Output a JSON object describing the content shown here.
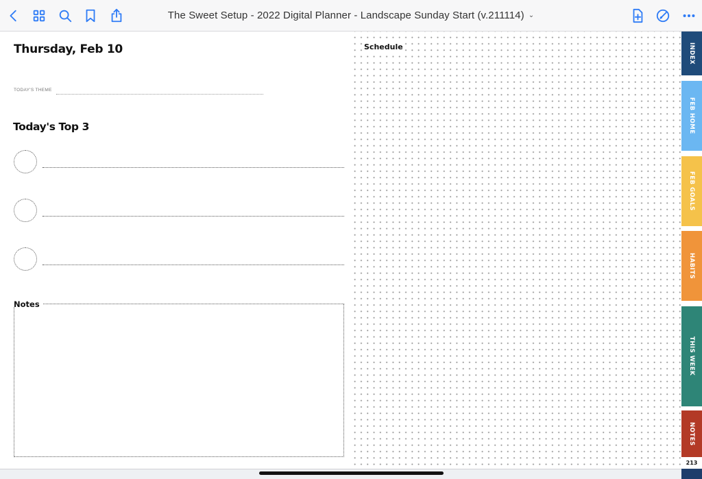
{
  "toolbar": {
    "title": "The Sweet Setup - 2022 Digital Planner - Landscape Sunday Start (v.211114)",
    "title_chevron": "⌄",
    "left_icons": [
      "back-icon",
      "grid-icon",
      "search-icon",
      "bookmark-icon",
      "share-icon"
    ],
    "right_icons": [
      "add-page-icon",
      "annotate-icon",
      "more-icon"
    ],
    "accent_color": "#2f7cf6"
  },
  "page": {
    "date": "Thursday, Feb 10",
    "theme_label": "TODAY'S THEME",
    "top3_heading": "Today's Top 3",
    "top3_count": 3,
    "notes_label": "Notes",
    "schedule_label": "Schedule",
    "page_number": "213"
  },
  "tabs": [
    {
      "label": "INDEX",
      "color": "#1f4b7a"
    },
    {
      "label": "FEB HOME",
      "color": "#6bb7f2"
    },
    {
      "label": "FEB GOALS",
      "color": "#f5c24a"
    },
    {
      "label": "HABITS",
      "color": "#f0943a"
    },
    {
      "label": "THIS WEEK",
      "color": "#2e8577"
    },
    {
      "label": "NOTES",
      "color": "#b33a26"
    }
  ]
}
